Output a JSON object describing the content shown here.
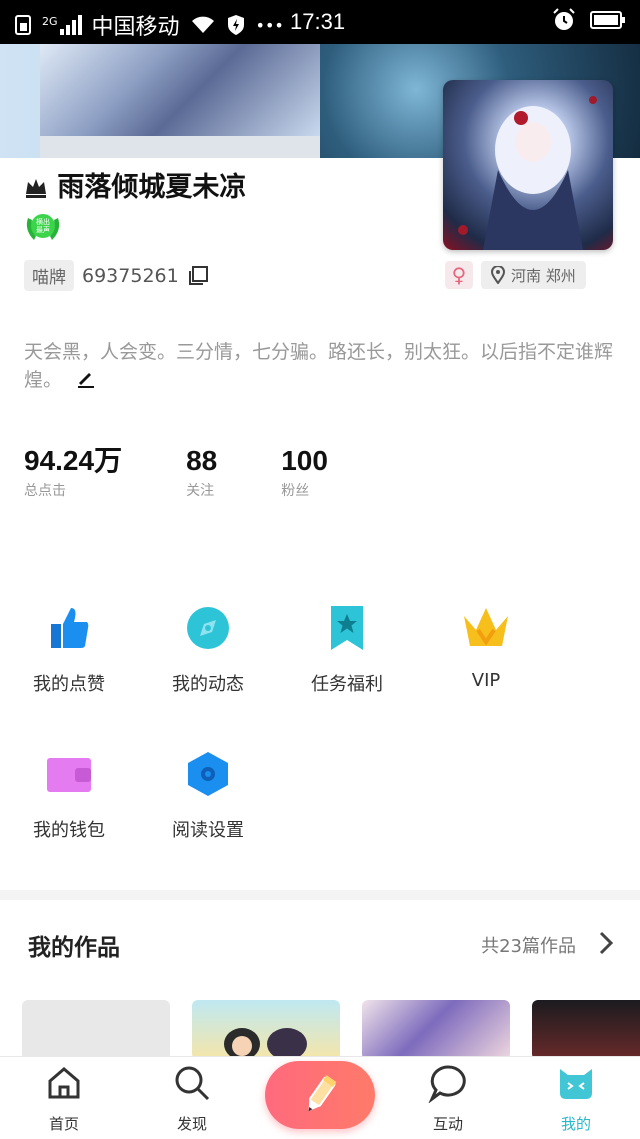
{
  "status_bar": {
    "network": "2G",
    "carrier": "中国移动",
    "more": "•••",
    "time": "17:31"
  },
  "profile": {
    "crown_icon": "crown-icon",
    "name": "雨落倾城夏未凉",
    "badge_text": "横出最声",
    "id_label": "喵牌",
    "id_value": "69375261",
    "gender_symbol": "♀",
    "location": "河南 郑州",
    "bio": "天会黑，人会变。三分情，七分骗。路还长，别太狂。以后指不定谁辉煌。"
  },
  "stats": [
    {
      "value": "94.24万",
      "label": "总点击"
    },
    {
      "value": "88",
      "label": "关注"
    },
    {
      "value": "100",
      "label": "粉丝"
    }
  ],
  "menu": [
    {
      "label": "我的点赞",
      "icon": "thumbs-up-icon",
      "color": "#1b8ff0"
    },
    {
      "label": "我的动态",
      "icon": "compass-icon",
      "color": "#2ec4d8"
    },
    {
      "label": "任务福利",
      "icon": "bookmark-star-icon",
      "color": "#2ec4d8"
    },
    {
      "label": "VIP",
      "icon": "crown-icon",
      "color": "#f6bf1c"
    },
    {
      "label": "我的钱包",
      "icon": "wallet-icon",
      "color": "#e47bf0"
    },
    {
      "label": "阅读设置",
      "icon": "hexagon-settings-icon",
      "color": "#1b8ff0"
    }
  ],
  "works": {
    "title": "我的作品",
    "count": "共23篇作品"
  },
  "tabs": [
    {
      "label": "首页",
      "icon": "home-icon"
    },
    {
      "label": "发现",
      "icon": "search-icon"
    },
    {
      "label": "",
      "icon": "pencil-icon"
    },
    {
      "label": "互动",
      "icon": "chat-bubble-icon"
    },
    {
      "label": "我的",
      "icon": "cat-face-icon"
    }
  ],
  "colors": {
    "accent": "#2ab7c9",
    "write_button": "#ff6f78"
  }
}
